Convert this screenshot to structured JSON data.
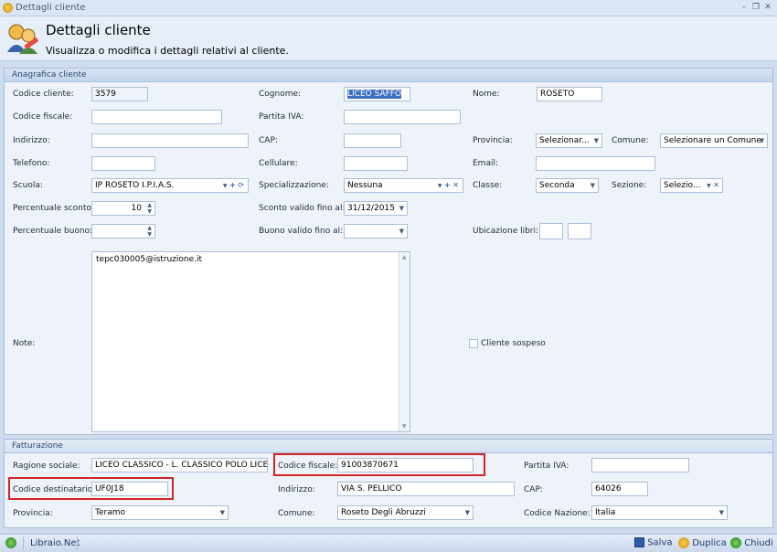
{
  "window": {
    "title": "Dettagli cliente"
  },
  "header": {
    "title": "Dettagli cliente",
    "subtitle": "Visualizza o modifica i dettagli relativi al cliente."
  },
  "anagrafica": {
    "section_title": "Anagrafica cliente",
    "codice_cliente": {
      "label": "Codice cliente:",
      "value": "3579"
    },
    "cognome": {
      "label": "Cognome:",
      "value": "LICEO SAFFO"
    },
    "nome": {
      "label": "Nome:",
      "value": "ROSETO"
    },
    "codice_fiscale": {
      "label": "Codice fiscale:",
      "value": ""
    },
    "partita_iva": {
      "label": "Partita IVA:",
      "value": ""
    },
    "indirizzo": {
      "label": "Indirizzo:",
      "value": ""
    },
    "cap": {
      "label": "CAP:",
      "value": ""
    },
    "provincia": {
      "label": "Provincia:",
      "value": "Selezionar..."
    },
    "comune": {
      "label": "Comune:",
      "value": "Selezionare un Comune"
    },
    "telefono": {
      "label": "Telefono:",
      "value": ""
    },
    "cellulare": {
      "label": "Cellulare:",
      "value": ""
    },
    "email": {
      "label": "Email:",
      "value": ""
    },
    "scuola": {
      "label": "Scuola:",
      "value": "IP ROSETO I.P.I.A.S."
    },
    "specializzazione": {
      "label": "Specializzazione:",
      "value": "Nessuna"
    },
    "classe": {
      "label": "Classe:",
      "value": "Seconda"
    },
    "sezione": {
      "label": "Sezione:",
      "value": "Selezio..."
    },
    "percentuale_sconto": {
      "label": "Percentuale sconto:",
      "value": "10"
    },
    "sconto_valido": {
      "label": "Sconto valido fino al:",
      "value": "31/12/2015"
    },
    "percentuale_buono": {
      "label": "Percentuale buono:",
      "value": ""
    },
    "buono_valido": {
      "label": "Buono valido fino al:",
      "value": ""
    },
    "ubicazione_libri": {
      "label": "Ubicazione libri:",
      "value": ""
    },
    "note": {
      "label": "Note:",
      "value": "tepc030005@istruzione.it"
    },
    "cliente_sospeso": {
      "label": "Cliente sospeso",
      "checked": false
    }
  },
  "fatturazione": {
    "section_title": "Fatturazione",
    "ragione_sociale": {
      "label": "Ragione sociale:",
      "value": "LICEO CLASSICO - L. CLASSICO POLO LICEALE"
    },
    "codice_fiscale": {
      "label": "Codice fiscale:",
      "value": "91003870671"
    },
    "partita_iva": {
      "label": "Partita IVA:",
      "value": ""
    },
    "codice_destinatario": {
      "label": "Codice destinatario:",
      "value": "UF0J18"
    },
    "indirizzo": {
      "label": "Indirizzo:",
      "value": "VIA S. PELLICO"
    },
    "cap": {
      "label": "CAP:",
      "value": "64026"
    },
    "provincia": {
      "label": "Provincia:",
      "value": "Teramo"
    },
    "comune": {
      "label": "Comune:",
      "value": "Roseto Degli Abruzzi"
    },
    "codice_nazione": {
      "label": "Codice Nazione:",
      "value": "Italia"
    }
  },
  "statusbar": {
    "app": "Libraio.Net",
    "salva": "Salva",
    "duplica": "Duplica",
    "chiudi": "Chiudi"
  },
  "colors": {
    "highlight": "#d02525",
    "selection": "#3a6fc4"
  }
}
